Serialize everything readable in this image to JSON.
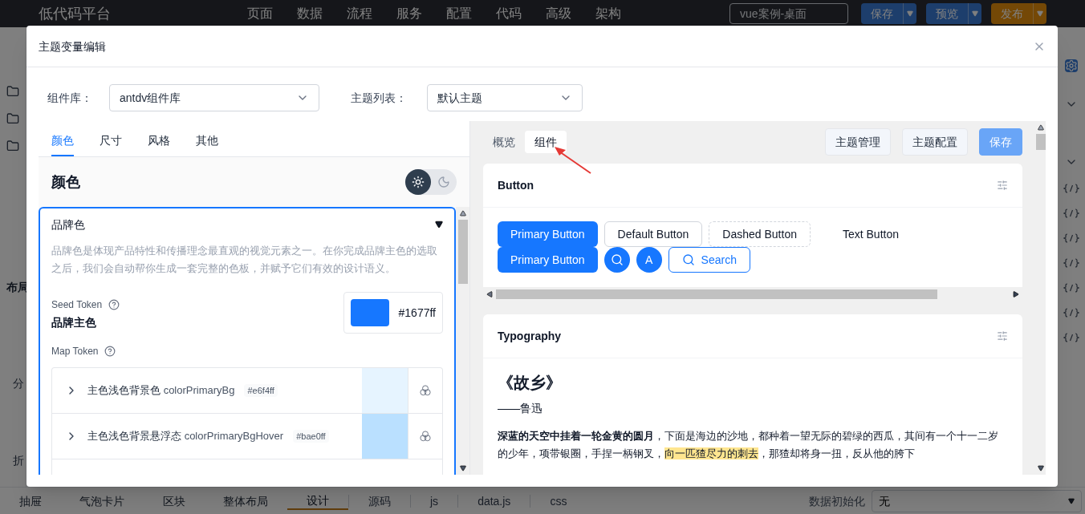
{
  "app": {
    "logo": "低代码平台",
    "nav": [
      "页面",
      "数据",
      "流程",
      "服务",
      "配置",
      "代码",
      "高级",
      "架构"
    ],
    "page_select": "vue案例-桌面",
    "actions": [
      {
        "label": "保存",
        "kind": "primary"
      },
      {
        "label": "预览",
        "kind": "primary"
      },
      {
        "label": "发布",
        "kind": "warning"
      }
    ]
  },
  "left_rail": {
    "labels": [
      "布局",
      "分",
      "折"
    ]
  },
  "bottom_bar": {
    "components": [
      "抽屉",
      "气泡卡片",
      "区块",
      "整体布局"
    ],
    "tabs": [
      {
        "label": "设计",
        "selected": true
      },
      {
        "label": "源码",
        "selected": false
      },
      {
        "label": "js",
        "selected": false
      },
      {
        "label": "data.js",
        "selected": false
      },
      {
        "label": "css",
        "selected": false
      }
    ],
    "init_label": "数据初始化",
    "init_value": "无"
  },
  "dialog": {
    "title": "主题变量编辑",
    "library_label": "组件库：",
    "library_value": "antdv组件库",
    "theme_label": "主题列表：",
    "theme_value": "默认主题",
    "token_tabs": [
      {
        "label": "颜色",
        "selected": true
      },
      {
        "label": "尺寸",
        "selected": false
      },
      {
        "label": "风格",
        "selected": false
      },
      {
        "label": "其他",
        "selected": false
      }
    ],
    "section_title": "颜色",
    "modes": [
      {
        "kind": "light",
        "selected": true
      },
      {
        "kind": "dark",
        "selected": false
      }
    ],
    "group": {
      "title": "品牌色",
      "expanded": true,
      "description": "品牌色是体现产品特性和传播理念最直观的视觉元素之一。在你完成品牌主色的选取之后，我们会自动帮你生成一套完整的色板，并赋予它们有效的设计语义。",
      "seed_label": "Seed Token",
      "seed_name": "品牌主色",
      "seed_color": "#1677ff",
      "map_label": "Map Token",
      "map_tokens": [
        {
          "name": "主色浅色背景色",
          "token": "colorPrimaryBg",
          "hex": "#e6f4ff",
          "color": "#e6f4ff",
          "expanded": false
        },
        {
          "name": "主色浅色背景悬浮态",
          "token": "colorPrimaryBgHover",
          "hex": "#bae0ff",
          "color": "#bae0ff",
          "expanded": false
        }
      ]
    },
    "preview": {
      "tabs": [
        {
          "label": "概览",
          "selected": false
        },
        {
          "label": "组件",
          "selected": true
        }
      ],
      "actions": [
        {
          "label": "主题管理",
          "kind": "default"
        },
        {
          "label": "主题配置",
          "kind": "default"
        },
        {
          "label": "保存",
          "kind": "primary"
        }
      ],
      "button_card": {
        "title": "Button",
        "buttons": [
          {
            "kind": "primary",
            "label": "Primary Button"
          },
          {
            "kind": "default",
            "label": "Default Button"
          },
          {
            "kind": "dashed",
            "label": "Dashed Button"
          },
          {
            "kind": "text",
            "label": "Text Button"
          },
          {
            "kind": "primary",
            "label": "Primary Button"
          },
          {
            "kind": "circle-icon"
          },
          {
            "kind": "circle",
            "label": "A"
          },
          {
            "kind": "outline-icon",
            "label": "Search"
          }
        ]
      },
      "typography_card": {
        "title": "Typography",
        "heading": "《故乡》",
        "author": "——鲁迅",
        "paragraph": [
          {
            "kind": "bold",
            "text": "深蓝的天空中挂着一轮金黄的圆月"
          },
          {
            "kind": "plain",
            "text": "，下面是海边的沙地，都种着一望无际的碧绿的西瓜，其间有一个十一二岁的少年，项带银圈，手捏一柄钢叉，"
          },
          {
            "kind": "mark",
            "text": "向一匹猹尽力的刺去"
          },
          {
            "kind": "plain",
            "text": "，那猹却将身一扭，反从他的胯下"
          }
        ]
      }
    }
  }
}
